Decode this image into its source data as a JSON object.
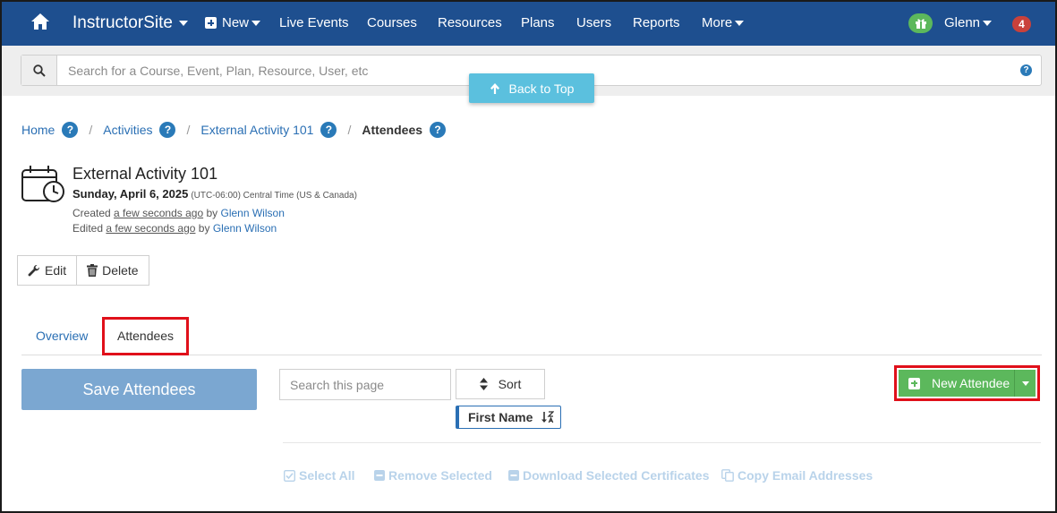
{
  "navbar": {
    "brand": "InstructorSite",
    "new_label": "New",
    "items": [
      "Live Events",
      "Courses",
      "Resources",
      "Plans",
      "Users",
      "Reports"
    ],
    "more_label": "More",
    "user_label": "Glenn",
    "notification_count": "4"
  },
  "search": {
    "placeholder": "Search for a Course, Event, Plan, Resource, User, etc",
    "help": "?"
  },
  "back_to_top": "Back to Top",
  "breadcrumb": {
    "items": [
      "Home",
      "Activities",
      "External Activity 101"
    ],
    "current": "Attendees",
    "help": "?",
    "separator": "/"
  },
  "event": {
    "title": "External Activity 101",
    "date": "Sunday, April 6, 2025",
    "timezone": "(UTC-06:00) Central Time (US & Canada)",
    "created_prefix": "Created",
    "created_time": "a few seconds ago",
    "created_by": "by",
    "created_user": "Glenn Wilson",
    "edited_prefix": "Edited",
    "edited_time": "a few seconds ago",
    "edited_by": "by",
    "edited_user": "Glenn Wilson"
  },
  "actions": {
    "edit": "Edit",
    "delete": "Delete"
  },
  "tabs": {
    "overview": "Overview",
    "attendees": "Attendees"
  },
  "toolbar": {
    "save": "Save Attendees",
    "search_placeholder": "Search this page",
    "sort": "Sort",
    "sort_field": "First Name",
    "new_attendee": "New Attendee"
  },
  "bulk": {
    "select_all": "Select All",
    "remove_selected": "Remove Selected",
    "download_certificates": "Download Selected Certificates",
    "copy_emails": "Copy Email Addresses"
  },
  "colors": {
    "navbar": "#1e4f8f",
    "link": "#2a6fb4",
    "success": "#5cb85c",
    "info": "#5bc0de",
    "highlight": "#e0101a"
  }
}
